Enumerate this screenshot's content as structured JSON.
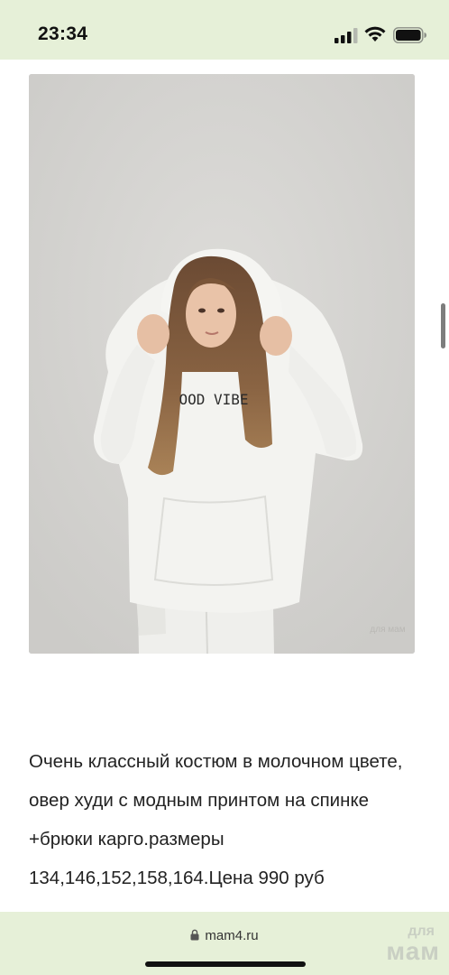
{
  "status_bar": {
    "time": "23:34"
  },
  "image": {
    "print_text": "OOD VIBE",
    "watermark": "для мам"
  },
  "description": {
    "text": "Очень классный костюм в молочном цвете, овер худи с модным принтом на спинке +брюки карго.размеры 134,146,152,158,164.Цена 990 руб"
  },
  "url_bar": {
    "url": "mam4.ru"
  },
  "watermark": {
    "top": "для",
    "bottom": "мам"
  },
  "colors": {
    "bar_background": "#e6f0d8",
    "text": "#222222"
  }
}
